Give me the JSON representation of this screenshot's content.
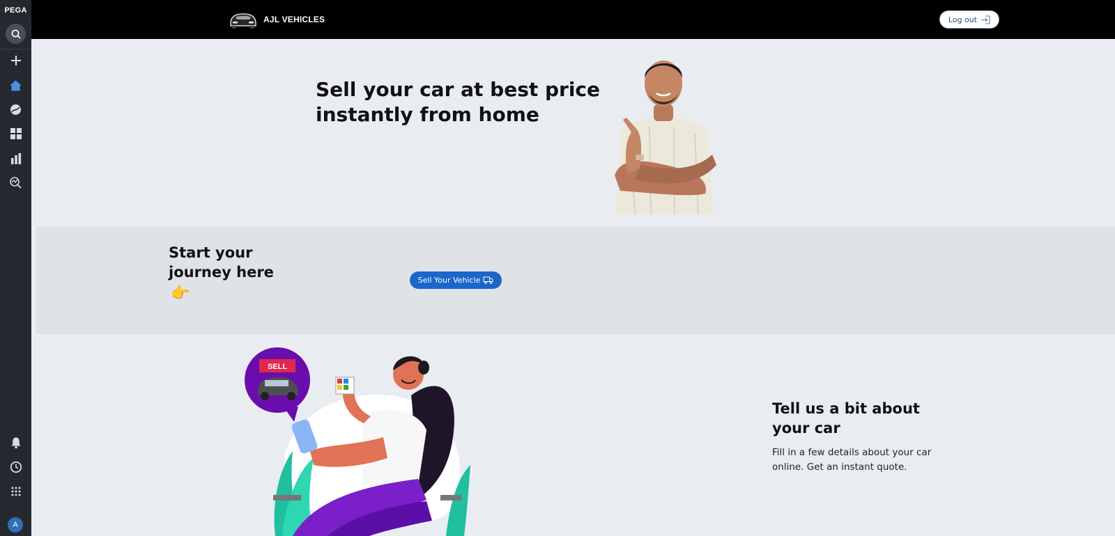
{
  "rail": {
    "brand": "PEGA",
    "items": [
      {
        "icon": "plus-icon"
      },
      {
        "icon": "home-icon"
      },
      {
        "icon": "explore-icon"
      },
      {
        "icon": "dashboard-grid-icon"
      },
      {
        "icon": "bar-chart-icon"
      },
      {
        "icon": "insights-icon"
      }
    ],
    "bottom": [
      {
        "icon": "bell-icon"
      },
      {
        "icon": "history-icon"
      },
      {
        "icon": "app-launcher-icon"
      }
    ],
    "avatar_initial": "A",
    "colors": {
      "rail_bg": "#25292f",
      "active_icon": "#4a90e2"
    }
  },
  "header": {
    "brand_name": "AJL VEHICLES",
    "logout_label": "Log out"
  },
  "hero": {
    "title": "Sell your car at best price instantly from home"
  },
  "journey": {
    "title": "Start your journey here",
    "emoji": "👉",
    "button_label": "Sell Your Vehicle",
    "button_color": "#1b66c9"
  },
  "info": {
    "illustration_tag": "SELL",
    "title": "Tell us a bit about your car",
    "text": "Fill in a few details about your car online. Get an instant quote."
  }
}
